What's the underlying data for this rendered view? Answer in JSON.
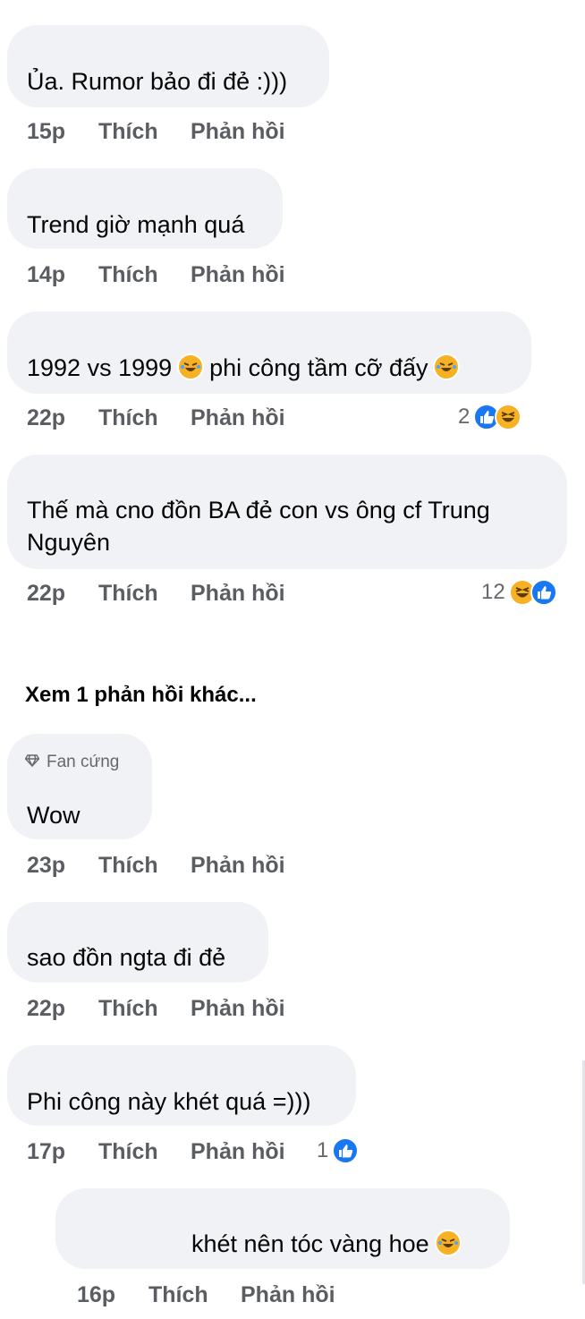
{
  "comments": [
    {
      "text": "Ủa. Rumor bảo đi đẻ :)))",
      "time": "15p",
      "like": "Thích",
      "reply": "Phản hồi"
    },
    {
      "text": "Trend giờ mạnh quá",
      "time": "14p",
      "like": "Thích",
      "reply": "Phản hồi"
    },
    {
      "text_a": "1992 vs 1999",
      "text_b": "phi công tầm cỡ đấy",
      "time": "22p",
      "like": "Thích",
      "reply": "Phản hồi",
      "reaction_count": "2",
      "reactions": [
        "like-icon",
        "haha-icon"
      ]
    },
    {
      "text": "Thế mà cno đồn BA đẻ con vs ông cf Trung Nguyên",
      "time": "22p",
      "like": "Thích",
      "reply": "Phản hồi",
      "reaction_count": "12",
      "reactions": [
        "haha-icon",
        "like-icon"
      ]
    },
    {
      "badge": "Fan cứng",
      "text": "Wow",
      "time": "23p",
      "like": "Thích",
      "reply": "Phản hồi"
    },
    {
      "text": "sao đồn ngta đi đẻ",
      "time": "22p",
      "like": "Thích",
      "reply": "Phản hồi"
    },
    {
      "text": "Phi công này khét quá =)))",
      "time": "17p",
      "like": "Thích",
      "reply": "Phản hồi",
      "reaction_count": "1",
      "reactions": [
        "like-icon"
      ]
    },
    {
      "text": "khét nên tóc vàng hoe",
      "time": "16p",
      "like": "Thích",
      "reply": "Phản hồi"
    }
  ],
  "more_replies": "Xem 1 phản hồi khác...",
  "colors": {
    "bubble": "#f0f2f5",
    "meta": "#5a5d61",
    "like": "#1877f2",
    "haha": "#f7b125"
  }
}
